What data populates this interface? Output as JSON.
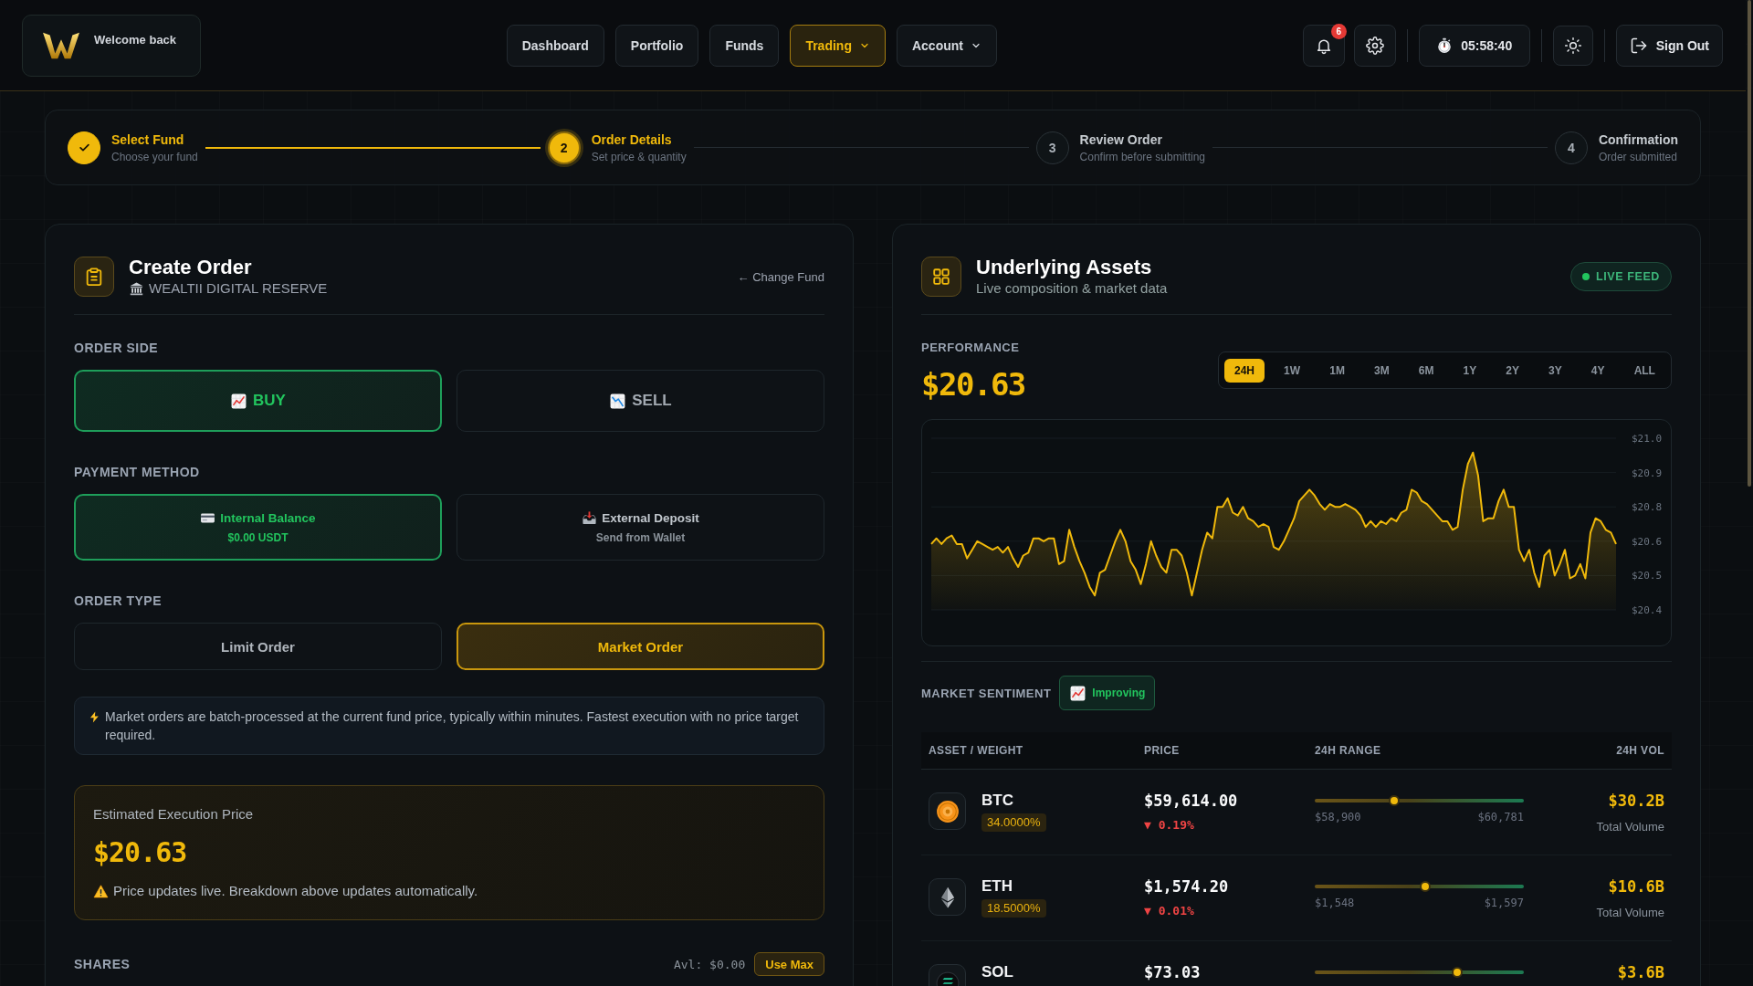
{
  "header": {
    "greeting": "Welcome back",
    "nav": [
      {
        "label": "Dashboard",
        "selected": false,
        "dropdown": false
      },
      {
        "label": "Portfolio",
        "selected": false,
        "dropdown": false
      },
      {
        "label": "Funds",
        "selected": false,
        "dropdown": false
      },
      {
        "label": "Trading",
        "selected": true,
        "dropdown": true
      },
      {
        "label": "Account",
        "selected": false,
        "dropdown": true
      }
    ],
    "notification_count": "6",
    "timer": "05:58:40",
    "sign_out": "Sign Out"
  },
  "stepper": [
    {
      "title": "Select Fund",
      "subtitle": "Choose your fund",
      "completed": true,
      "selected": false
    },
    {
      "number": "2",
      "title": "Order Details",
      "subtitle": "Set price & quantity",
      "completed": false,
      "selected": true
    },
    {
      "number": "3",
      "title": "Review Order",
      "subtitle": "Confirm before submitting",
      "completed": false,
      "selected": false
    },
    {
      "number": "4",
      "title": "Confirmation",
      "subtitle": "Order submitted",
      "completed": false,
      "selected": false
    }
  ],
  "order_panel": {
    "title": "Create Order",
    "fund": "WEALTII DIGITAL RESERVE",
    "change_fund": "← Change Fund",
    "order_side": {
      "label": "ORDER SIDE",
      "options": [
        {
          "kind": "buy",
          "label": "BUY",
          "selected": true
        },
        {
          "kind": "sell",
          "label": "SELL",
          "selected": false
        }
      ]
    },
    "payment_method": {
      "label": "PAYMENT METHOD",
      "options": [
        {
          "kind": "balance",
          "label": "Internal Balance",
          "detail": "$0.00 USDT",
          "selected": true
        },
        {
          "kind": "deposit",
          "label": "External Deposit",
          "detail": "Send from Wallet",
          "selected": false
        }
      ]
    },
    "order_type": {
      "label": "ORDER TYPE",
      "options": [
        {
          "label": "Limit Order",
          "selected": false
        },
        {
          "label": "Market Order",
          "selected": true
        }
      ]
    },
    "info": "Market orders are batch-processed at the current fund price, typically within minutes. Fastest execution with no price target required.",
    "estimate": {
      "label": "Estimated Execution Price",
      "price": "$20.63",
      "note": "Price updates live. Breakdown above updates automatically."
    },
    "shares": {
      "label": "SHARES",
      "available": "Avl: $0.00",
      "use_max": "Use Max"
    }
  },
  "assets_panel": {
    "title": "Underlying Assets",
    "subtitle": "Live composition & market data",
    "live_badge": "LIVE FEED",
    "performance_label": "PERFORMANCE",
    "price": "$20.63",
    "ranges": [
      {
        "label": "24H",
        "selected": true
      },
      {
        "label": "1W",
        "selected": false
      },
      {
        "label": "1M",
        "selected": false
      },
      {
        "label": "3M",
        "selected": false
      },
      {
        "label": "6M",
        "selected": false
      },
      {
        "label": "1Y",
        "selected": false
      },
      {
        "label": "2Y",
        "selected": false
      },
      {
        "label": "3Y",
        "selected": false
      },
      {
        "label": "4Y",
        "selected": false
      },
      {
        "label": "ALL",
        "selected": false
      }
    ],
    "chart_data": [
      {
        "type": "area",
        "color": "#f0b90b",
        "grid": true,
        "tick_labels": "y",
        "ylim": [
          20.4,
          21.0
        ],
        "yticks": [
          {
            "value": 21.0,
            "label": "$21.0"
          },
          {
            "value": 20.88,
            "label": "$20.9"
          },
          {
            "value": 20.76,
            "label": "$20.8"
          },
          {
            "value": 20.64,
            "label": "$20.6"
          },
          {
            "value": 20.52,
            "label": "$20.5"
          },
          {
            "value": 20.4,
            "label": "$20.4"
          }
        ],
        "values": [
          20.63,
          20.65,
          20.63,
          20.65,
          20.66,
          20.63,
          20.63,
          20.58,
          20.61,
          20.64,
          20.63,
          20.62,
          20.61,
          20.62,
          20.6,
          20.62,
          20.58,
          20.55,
          20.59,
          20.6,
          20.65,
          20.65,
          20.64,
          20.65,
          20.65,
          20.56,
          20.57,
          20.68,
          20.62,
          20.57,
          20.53,
          20.48,
          20.45,
          20.53,
          20.54,
          20.59,
          20.64,
          20.68,
          20.64,
          20.57,
          20.54,
          20.49,
          20.56,
          20.64,
          20.59,
          20.55,
          20.53,
          20.61,
          20.61,
          20.59,
          20.53,
          20.45,
          20.53,
          20.61,
          20.67,
          20.65,
          20.76,
          20.76,
          20.79,
          20.74,
          20.73,
          20.76,
          20.72,
          20.71,
          20.69,
          20.7,
          20.69,
          20.62,
          20.61,
          20.64,
          20.68,
          20.72,
          20.78,
          20.8,
          20.82,
          20.8,
          20.77,
          20.75,
          20.77,
          20.76,
          20.76,
          20.77,
          20.76,
          20.75,
          20.73,
          20.69,
          20.71,
          20.69,
          20.71,
          20.7,
          20.72,
          20.71,
          20.74,
          20.75,
          20.82,
          20.81,
          20.78,
          20.77,
          20.75,
          20.73,
          20.71,
          20.71,
          20.68,
          20.69,
          20.82,
          20.91,
          20.95,
          20.87,
          20.71,
          20.72,
          20.72,
          20.78,
          20.82,
          20.76,
          20.76,
          20.61,
          20.57,
          20.61,
          20.53,
          20.48,
          20.59,
          20.61,
          20.52,
          20.56,
          20.61,
          20.51,
          20.52,
          20.56,
          20.51,
          20.67,
          20.72,
          20.71,
          20.68,
          20.67,
          20.63
        ]
      }
    ],
    "sentiment_label": "MARKET SENTIMENT",
    "sentiment": "Improving",
    "table": {
      "columns": [
        "ASSET / WEIGHT",
        "PRICE",
        "24H RANGE",
        "24H VOL"
      ],
      "rows": [
        {
          "kind": "btc",
          "asset": "BTC",
          "weight": "34.0000%",
          "price": "$59,614.00",
          "change": "▼ 0.19%",
          "falling": true,
          "level": 0.38,
          "low": "$58,900",
          "high": "$60,781",
          "volume": "$30.2B",
          "volume_label": "Total Volume"
        },
        {
          "kind": "eth",
          "asset": "ETH",
          "weight": "18.5000%",
          "price": "$1,574.20",
          "change": "▼ 0.01%",
          "falling": true,
          "level": 0.53,
          "low": "$1,548",
          "high": "$1,597",
          "volume": "$10.6B",
          "volume_label": "Total Volume"
        },
        {
          "kind": "sol",
          "asset": "SOL",
          "price": "$73.03",
          "level": 0.68,
          "volume": "$3.6B"
        }
      ]
    }
  }
}
